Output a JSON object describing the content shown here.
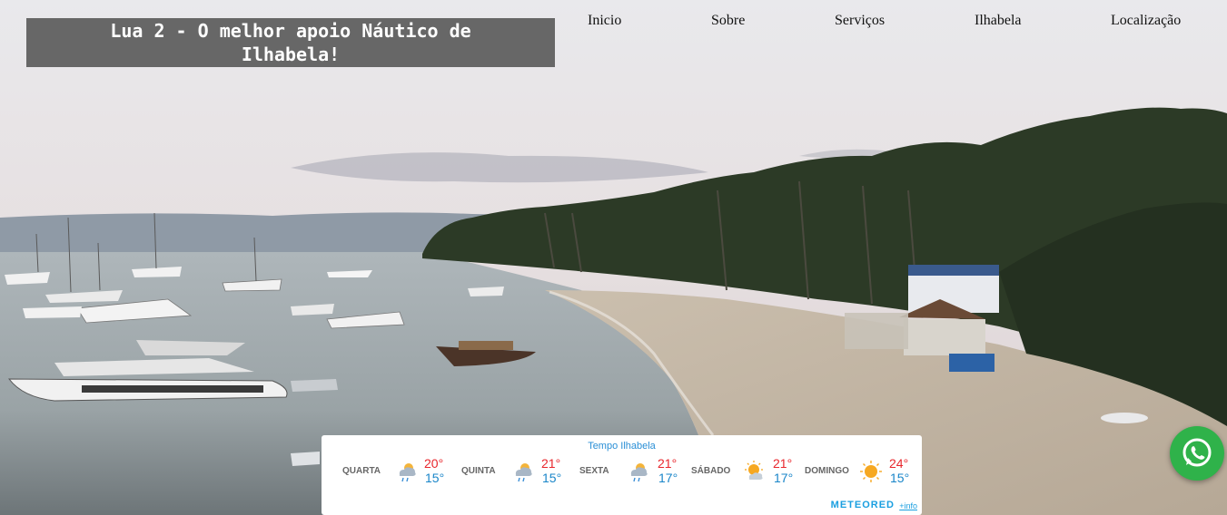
{
  "header": {
    "title_line1": "Lua 2 - O melhor apoio Náutico de",
    "title_line2": "Ilhabela!"
  },
  "nav": {
    "items": [
      {
        "label": "Inicio"
      },
      {
        "label": "Sobre"
      },
      {
        "label": "Serviços"
      },
      {
        "label": "Ilhabela"
      },
      {
        "label": "Localização"
      }
    ]
  },
  "weather": {
    "title": "Tempo Ilhabela",
    "days": [
      {
        "name": "QUARTA",
        "max": "20°",
        "min": "15°",
        "icon": "rain-cloud-icon"
      },
      {
        "name": "QUINTA",
        "max": "21°",
        "min": "15°",
        "icon": "rain-cloud-icon"
      },
      {
        "name": "SEXTA",
        "max": "21°",
        "min": "17°",
        "icon": "rain-cloud-icon"
      },
      {
        "name": "SÁBADO",
        "max": "21°",
        "min": "17°",
        "icon": "partly-sunny-icon"
      },
      {
        "name": "DOMINGO",
        "max": "24°",
        "min": "15°",
        "icon": "sun-icon"
      }
    ],
    "brand": "METEORED",
    "more_link": "+info"
  },
  "colors": {
    "title_bg": "#606060",
    "weather_max": "#e8262c",
    "weather_min": "#1a86c9",
    "whatsapp": "#2fb24a"
  }
}
